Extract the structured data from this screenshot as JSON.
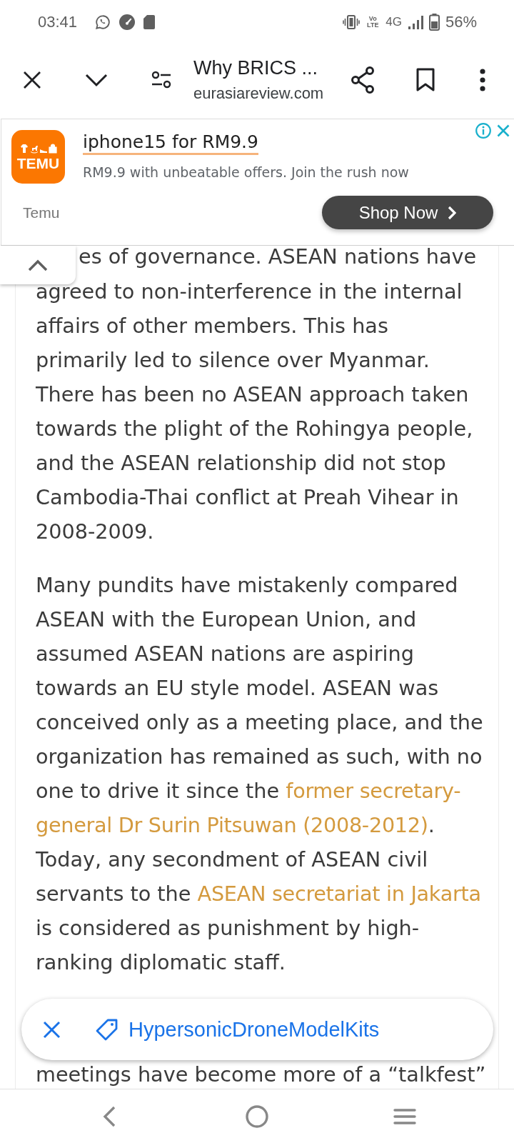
{
  "status_bar": {
    "time": "03:41",
    "volte": "Vo LTE",
    "network": "4G",
    "battery": "56%"
  },
  "toolbar": {
    "title": "Why BRICS ...",
    "url": "eurasiareview.com"
  },
  "ad": {
    "logo_text": "TEMU",
    "headline": "iphone15 for RM9.9",
    "description": "RM9.9 with unbeatable offers. Join the rush now",
    "advertiser": "Temu",
    "button": "Shop Now"
  },
  "article": {
    "cut_top_line": "es of governance. ASEAN nations have",
    "paragraphs": [
      {
        "segments": [
          {
            "kind": "text",
            "text": "agreed to non-interference in the internal affairs of other members. This has primarily led to silence over Myanmar. There has been no ASEAN approach taken towards the plight of the Rohingya people, and the ASEAN relationship did not stop Cambodia-Thai conflict at Preah Vihear in 2008-2009."
          }
        ]
      },
      {
        "segments": [
          {
            "kind": "text",
            "text": "Many pundits have mistakenly compared ASEAN with the European Union, and assumed ASEAN nations are aspiring towards an EU style model. ASEAN was conceived only as a meeting place, and the organization has remained as such, with no one to drive it since the "
          },
          {
            "kind": "link",
            "text": "former secretary-"
          },
          {
            "kind": "link",
            "text": "general Dr Surin Pitsuwan (2008-2012)"
          },
          {
            "kind": "text",
            "text": ". Today, any secondment of ASEAN civil servants to the "
          },
          {
            "kind": "link",
            "text": "ASEAN secretariat in Jakarta"
          },
          {
            "kind": "text",
            "text": " is considered as punishment by high-ranking diplomatic staff."
          }
        ]
      }
    ],
    "cut_bottom_line": "meetings have become more of a “talkfest”"
  },
  "chip": {
    "label": "HypersonicDroneModelKits"
  }
}
